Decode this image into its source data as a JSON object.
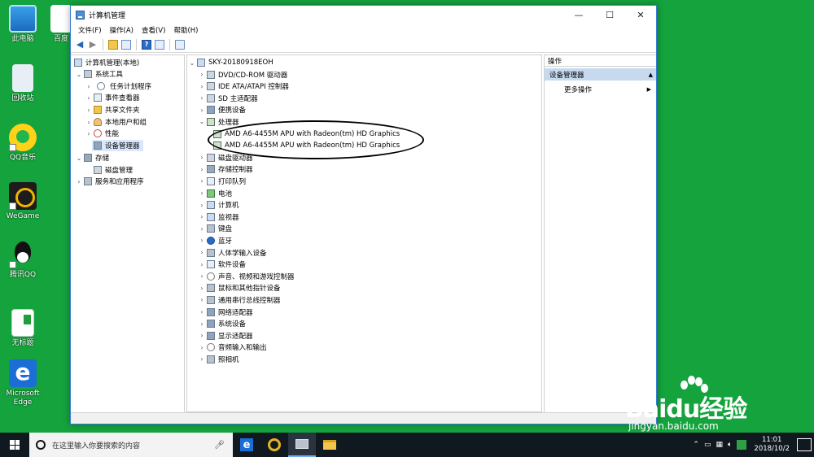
{
  "desktop": {
    "icons": [
      {
        "label": "此电脑"
      },
      {
        "label": "回收站"
      },
      {
        "label": "QQ音乐"
      },
      {
        "label": "WeGame"
      },
      {
        "label": "腾讯QQ"
      },
      {
        "label": "无标题"
      },
      {
        "label": "Microsoft Edge"
      }
    ],
    "partial_icon_label": "百度"
  },
  "window": {
    "title": "计算机管理",
    "controls": {
      "minimize": "—",
      "maximize": "☐",
      "close": "✕"
    },
    "menu": [
      "文件(F)",
      "操作(A)",
      "查看(V)",
      "帮助(H)"
    ]
  },
  "left_tree": [
    {
      "label": "计算机管理(本地)",
      "icon": "computer-management-icon"
    },
    {
      "label": "系统工具",
      "icon": "system-tools-icon"
    },
    {
      "label": "任务计划程序",
      "icon": "task-scheduler-icon"
    },
    {
      "label": "事件查看器",
      "icon": "event-viewer-icon"
    },
    {
      "label": "共享文件夹",
      "icon": "shared-folders-icon"
    },
    {
      "label": "本地用户和组",
      "icon": "local-users-icon"
    },
    {
      "label": "性能",
      "icon": "performance-icon"
    },
    {
      "label": "设备管理器",
      "icon": "device-manager-icon"
    },
    {
      "label": "存储",
      "icon": "storage-icon"
    },
    {
      "label": "磁盘管理",
      "icon": "disk-management-icon"
    },
    {
      "label": "服务和应用程序",
      "icon": "services-icon"
    }
  ],
  "device_tree": {
    "root": "SKY-20180918EOH",
    "categories": [
      "DVD/CD-ROM 驱动器",
      "IDE ATA/ATAPI 控制器",
      "SD 主适配器",
      "便携设备",
      "处理器",
      "磁盘驱动器",
      "存储控制器",
      "打印队列",
      "电池",
      "计算机",
      "监视器",
      "键盘",
      "蓝牙",
      "人体学输入设备",
      "软件设备",
      "声音、视频和游戏控制器",
      "鼠标和其他指针设备",
      "通用串行总线控制器",
      "网络适配器",
      "系统设备",
      "显示适配器",
      "音频输入和输出",
      "照相机"
    ],
    "processors": [
      "AMD A6-4455M APU with Radeon(tm) HD Graphics",
      "AMD A6-4455M APU with Radeon(tm) HD Graphics"
    ]
  },
  "actions": {
    "header": "操作",
    "section": "设备管理器",
    "more": "更多操作"
  },
  "taskbar": {
    "search_placeholder": "在这里输入你要搜索的内容",
    "time": "11:01",
    "date": "2018/10/2"
  },
  "watermark": {
    "logo": "Baidu经验",
    "url": "jingyan.baidu.com"
  },
  "colors": {
    "desktop": "#14a33c",
    "selection": "#d9e8fb",
    "actions_section": "#c6d9ef",
    "taskbar": "#101820"
  }
}
